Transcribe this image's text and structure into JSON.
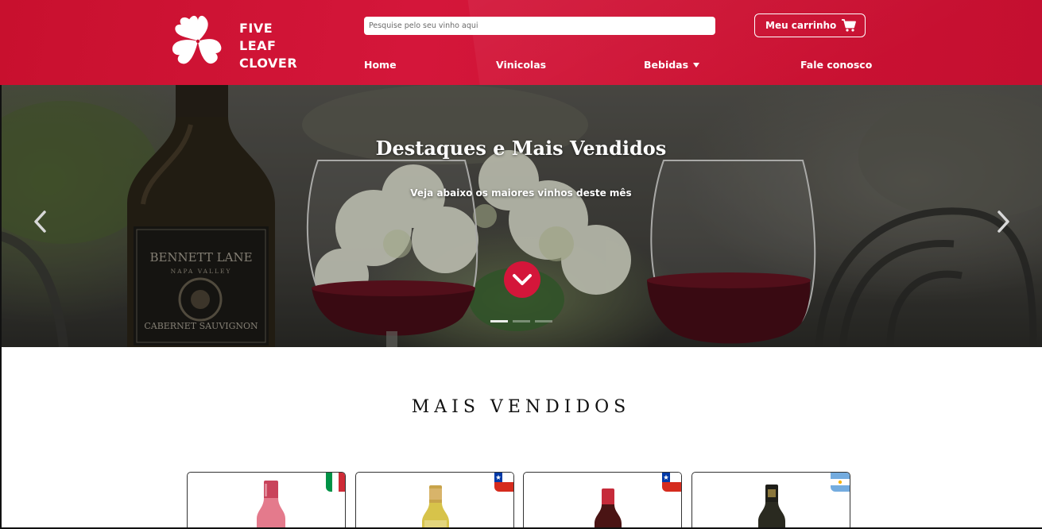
{
  "brand": {
    "name_lines": [
      "FIVE",
      "LEAF",
      "CLOVER"
    ],
    "primary_color": "#d4163a"
  },
  "search": {
    "placeholder": "Pesquise pelo seu vinho aqui",
    "value": ""
  },
  "cart": {
    "label": "Meu carrinho",
    "icon": "cart-icon"
  },
  "nav": [
    {
      "label": "Home"
    },
    {
      "label": "Vinicolas"
    },
    {
      "label": "Bebidas",
      "icon": "caret-down-icon"
    },
    {
      "label": "Fale conosco"
    }
  ],
  "hero": {
    "title": "Destaques e Mais Vendidos",
    "subtitle": "Veja abaixo os maiores vinhos deste mês",
    "bottle_label_lines": [
      "BENNETT LANE",
      "NAPA VALLEY",
      "CABERNET SAUVIGNON"
    ],
    "slides": 3,
    "active_slide": 1
  },
  "section": {
    "title": "MAIS VENDIDOS"
  },
  "products": [
    {
      "country": "Italy",
      "flag_colors": [
        "#009246",
        "#ffffff",
        "#ce2b37"
      ],
      "bottle_color": "#c9435b"
    },
    {
      "country": "Chile",
      "flag_colors": [
        "#0039a6",
        "#ffffff",
        "#d52b1e"
      ],
      "bottle_color": "#d7c34a"
    },
    {
      "country": "Chile",
      "flag_colors": [
        "#0039a6",
        "#ffffff",
        "#d52b1e"
      ],
      "bottle_color": "#6e1b1b"
    },
    {
      "country": "Argentina",
      "flag_colors": [
        "#74acdf",
        "#ffffff",
        "#74acdf"
      ],
      "bottle_color": "#1e1e18"
    }
  ]
}
